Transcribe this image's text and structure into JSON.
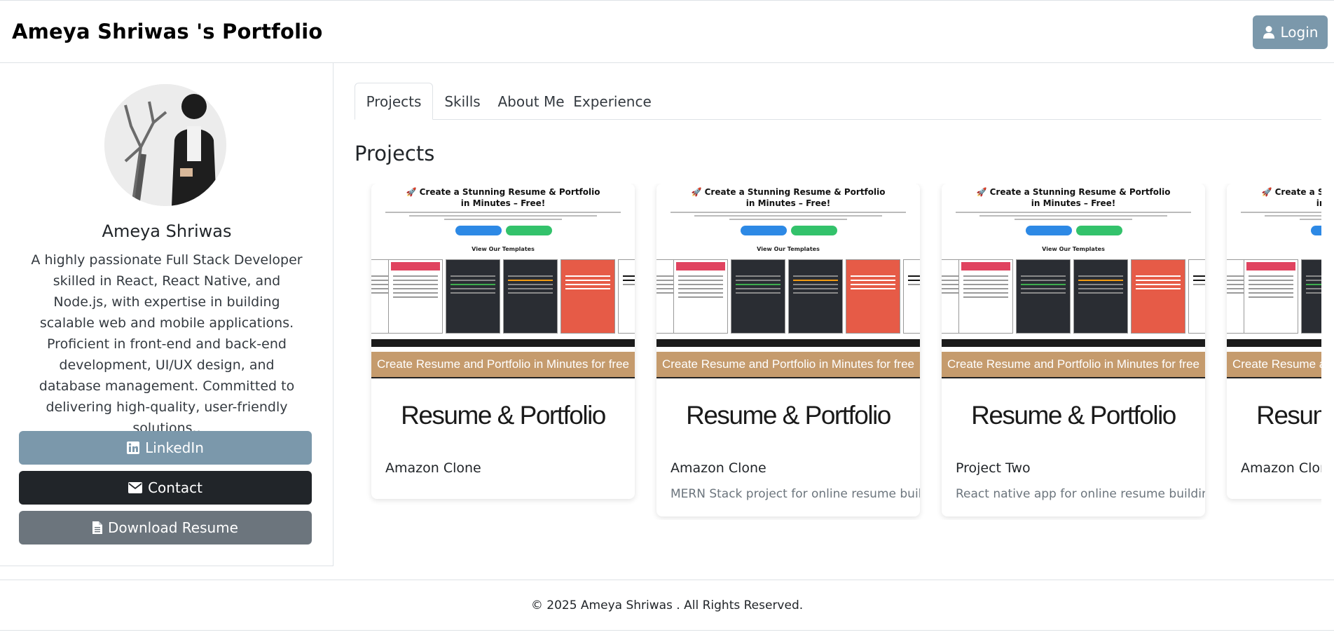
{
  "header": {
    "brand": "Ameya Shriwas 's Portfolio",
    "login_label": "Login"
  },
  "sidebar": {
    "name": "Ameya Shriwas",
    "bio": "A highly passionate Full Stack Developer skilled in React, React Native, and Node.js, with expertise in building scalable web and mobile applications. Proficient in front-end and back-end development, UI/UX design, and database management. Committed to delivering high-quality, user-friendly solutions..",
    "buttons": {
      "linkedin": "LinkedIn",
      "contact": "Contact",
      "resume": "Download Resume"
    }
  },
  "tabs": [
    "Projects",
    "Skills",
    "About Me",
    "Experience"
  ],
  "active_tab": "Projects",
  "section_title": "Projects",
  "project_card_common": {
    "screenshot_title_line1": "🚀 Create a Stunning Resume & Portfolio",
    "screenshot_title_line2": "in Minutes – Free!",
    "templates_label": "View Our Templates",
    "banner": "Create Resume and Portfolio in Minutes for free",
    "wordmark": "Resume & Portfolio"
  },
  "projects": [
    {
      "title": "Amazon Clone",
      "description": ""
    },
    {
      "title": "Amazon Clone",
      "description": "MERN Stack project for online resume building"
    },
    {
      "title": "Project Two",
      "description": "React native app for online resume building"
    },
    {
      "title": "Amazon Clone",
      "description": ""
    }
  ],
  "footer": {
    "text": "© 2025 Ameya Shriwas . All Rights Reserved."
  },
  "colors": {
    "primary_button": "#7b98ab",
    "dark_button": "#212529",
    "secondary_button": "#6c757d",
    "banner": "#c59b6d"
  },
  "icons": {
    "login": "user-icon",
    "linkedin": "linkedin-icon",
    "contact": "envelope-icon",
    "resume": "file-icon"
  }
}
